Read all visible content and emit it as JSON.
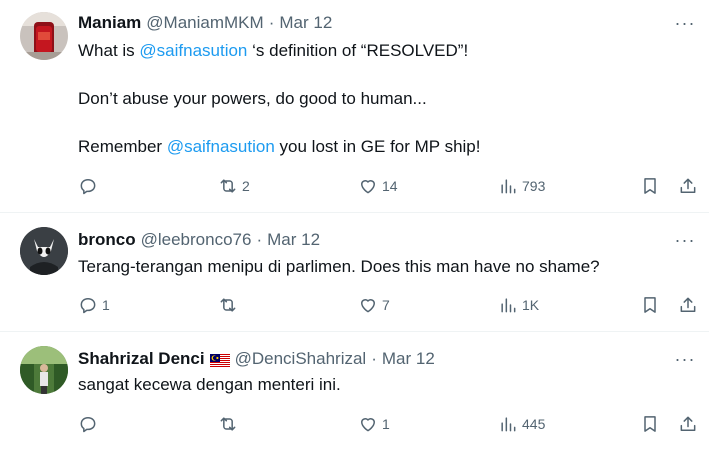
{
  "tweets": [
    {
      "name": "Maniam",
      "handle": "@ManiamMKM",
      "dot": "·",
      "date": "Mar 12",
      "more": "···",
      "text": {
        "p1_a": "What is ",
        "p1_mention": "@saifnasution",
        "p1_b": " ‘s definition of “RESOLVED”!",
        "p2": "Don’t abuse your powers, do good to human...",
        "p3_a": "Remember ",
        "p3_mention": "@saifnasution",
        "p3_b": " you lost in GE for MP ship!"
      },
      "stats": {
        "replies": "",
        "reposts": "2",
        "likes": "14",
        "views": "793"
      }
    },
    {
      "name": "bronco",
      "handle": "@leebronco76",
      "dot": "·",
      "date": "Mar 12",
      "more": "···",
      "text": {
        "p1": "Terang-terangan menipu di parlimen. Does this man have no shame?"
      },
      "stats": {
        "replies": "1",
        "reposts": "",
        "likes": "7",
        "views": "1K"
      }
    },
    {
      "name": "Shahrizal Denci",
      "handle": "@DenciShahrizal",
      "dot": "·",
      "date": "Mar 12",
      "more": "···",
      "text": {
        "p1": "sangat kecewa dengan menteri ini."
      },
      "stats": {
        "replies": "",
        "reposts": "",
        "likes": "1",
        "views": "445"
      }
    }
  ],
  "icons": {
    "reply": "reply-icon",
    "repost": "repost-icon",
    "like": "heart-icon",
    "views": "views-icon",
    "bookmark": "bookmark-icon",
    "share": "share-icon",
    "flag": "malaysia-flag-icon"
  },
  "colors": {
    "accent": "#1d9bf0",
    "text": "#0f1419",
    "muted": "#536471",
    "divider": "#eff3f4"
  }
}
